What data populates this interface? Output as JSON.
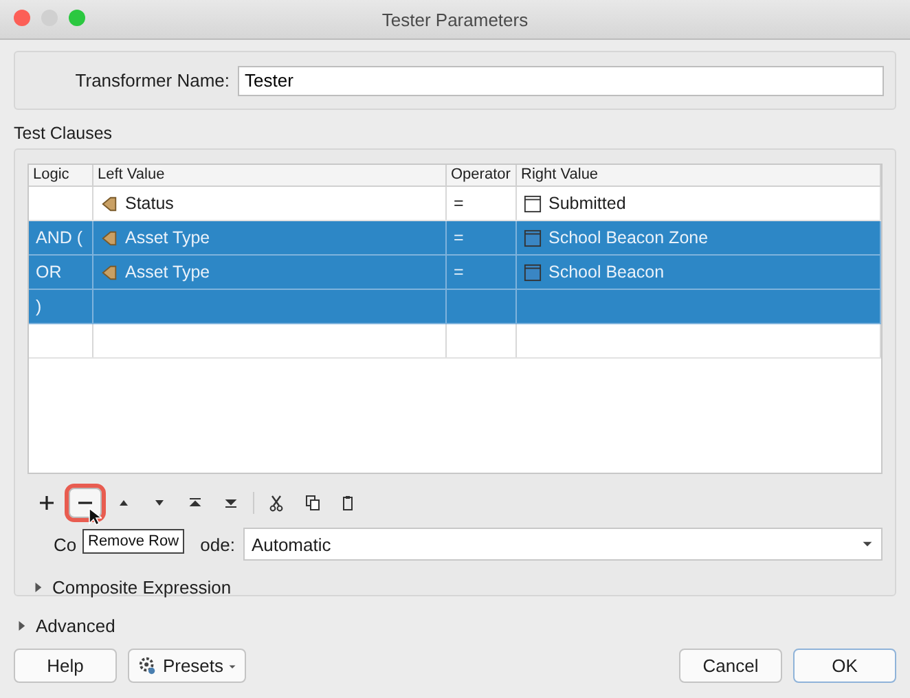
{
  "window": {
    "title": "Tester Parameters"
  },
  "transformer_name": {
    "label": "Transformer Name:",
    "value": "Tester"
  },
  "test_clauses": {
    "title": "Test Clauses",
    "table": {
      "columns": [
        "Logic",
        "Left Value",
        "Operator",
        "Right Value"
      ],
      "rows": [
        {
          "logic": "",
          "left": "Status",
          "operator": "=",
          "right": "Submitted",
          "selected": false
        },
        {
          "logic": "AND (",
          "left": "Asset Type",
          "operator": "=",
          "right": "School Beacon Zone",
          "selected": true
        },
        {
          "logic": "OR",
          "left": "Asset Type",
          "operator": "=",
          "right": "School Beacon",
          "selected": true
        },
        {
          "logic": ")",
          "left": "",
          "operator": "",
          "right": "",
          "selected": true
        },
        {
          "logic": "",
          "left": "",
          "operator": "",
          "right": "",
          "selected": false
        }
      ]
    },
    "toolbar": [
      {
        "kind": "plus",
        "highlighted": false
      },
      {
        "kind": "minus",
        "highlighted": true
      },
      {
        "kind": "up",
        "highlighted": false
      },
      {
        "kind": "down",
        "highlighted": false
      },
      {
        "kind": "top",
        "highlighted": false
      },
      {
        "kind": "bottom",
        "highlighted": false
      },
      {
        "kind": "cut",
        "highlighted": false
      },
      {
        "kind": "copy",
        "highlighted": false
      },
      {
        "kind": "paste",
        "highlighted": false
      }
    ],
    "tooltip": "Remove Row",
    "composite_mode": {
      "label_start": "Co",
      "label_end": "ode:",
      "value": "Automatic"
    },
    "composite_expression": {
      "label": "Composite Expression",
      "expanded": false
    }
  },
  "advanced": {
    "label": "Advanced",
    "expanded": false
  },
  "buttons": {
    "help": "Help",
    "presets": "Presets",
    "cancel": "Cancel",
    "ok": "OK"
  }
}
